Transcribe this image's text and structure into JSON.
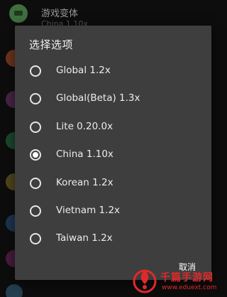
{
  "background_list": {
    "top_item": {
      "title": "游戏变体",
      "subtitle": "China 1.10x"
    },
    "side_circle_colors": [
      "#c05a2b",
      "#7a3a7a",
      "#2b7a4a",
      "#8a7a2b",
      "#2b5a8a",
      "#7a2b6a",
      "#3a6a8a"
    ]
  },
  "dialog": {
    "title": "选择选项",
    "options": [
      {
        "label": "Global 1.2x",
        "selected": false
      },
      {
        "label": "Global(Beta) 1.3x",
        "selected": false
      },
      {
        "label": "Lite 0.20.0x",
        "selected": false
      },
      {
        "label": "China 1.10x",
        "selected": true
      },
      {
        "label": "Korean 1.2x",
        "selected": false
      },
      {
        "label": "Vietnam 1.2x",
        "selected": false
      },
      {
        "label": "Taiwan 1.2x",
        "selected": false
      }
    ],
    "cancel_label": "取消"
  },
  "watermark": {
    "text": "千篇手游网",
    "url": "www.eduext.com",
    "color": "#e0292a"
  }
}
